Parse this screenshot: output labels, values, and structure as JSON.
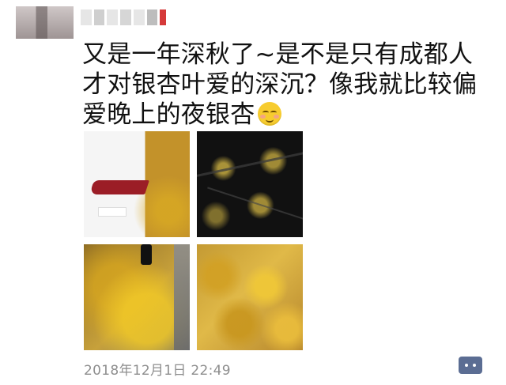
{
  "post": {
    "text": "又是一年深秋了~是不是只有成都人才对银杏叶爱的深沉？像我就比较偏爱晚上的夜银杏",
    "timestamp": "2018年12月1日  22:49",
    "photos": [
      {
        "label": ""
      },
      {
        "label": ""
      },
      {
        "label": ""
      },
      {
        "label": ""
      }
    ]
  },
  "icons": {
    "avatar": "avatar",
    "emoji": "relieved-face-emoji",
    "comment": "comment-bubble-icon"
  },
  "colors": {
    "text": "#111111",
    "timestamp": "#8e8e8e",
    "comment_button": "#5b6d93",
    "emoji": "#f7cc2f"
  }
}
